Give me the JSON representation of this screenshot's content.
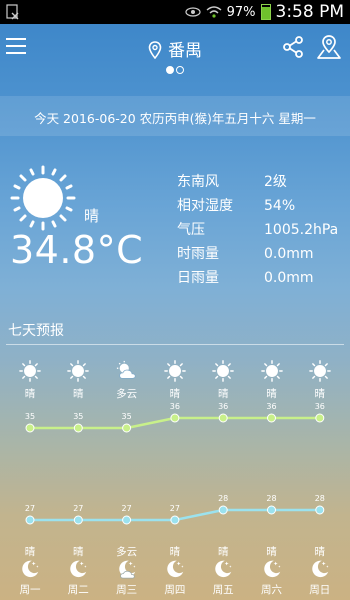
{
  "statusbar": {
    "signal_percent": "97%",
    "time": "3:58 PM",
    "icons": [
      "notification-icon",
      "eye-icon",
      "wifi-icon",
      "battery-icon"
    ]
  },
  "header": {
    "city": "番禺",
    "page_count": 2,
    "active_page": 0
  },
  "today": {
    "date_line": "今天   2016-06-20  农历丙申(猴)年五月十六  星期一",
    "condition": "晴",
    "temperature": "34.8°C",
    "details": [
      {
        "label": "东南风",
        "value": "2级"
      },
      {
        "label": "相对湿度",
        "value": "54%"
      },
      {
        "label": "气压",
        "value": "1005.2hPa"
      },
      {
        "label": "时雨量",
        "value": "0.0mm"
      },
      {
        "label": "日雨量",
        "value": "0.0mm"
      }
    ]
  },
  "week": {
    "title": "七天预报",
    "days": [
      {
        "day_icon": "sun-icon",
        "day_cond": "晴",
        "high": 35,
        "low": 27,
        "night_cond": "晴",
        "night_icon": "moon-icon",
        "name": "周一"
      },
      {
        "day_icon": "sun-icon",
        "day_cond": "晴",
        "high": 35,
        "low": 27,
        "night_cond": "晴",
        "night_icon": "moon-icon",
        "name": "周二"
      },
      {
        "day_icon": "cloud-sun-icon",
        "day_cond": "多云",
        "high": 35,
        "low": 27,
        "night_cond": "多云",
        "night_icon": "cloud-moon-icon",
        "name": "周三"
      },
      {
        "day_icon": "sun-icon",
        "day_cond": "晴",
        "high": 36,
        "low": 27,
        "night_cond": "晴",
        "night_icon": "moon-icon",
        "name": "周四"
      },
      {
        "day_icon": "sun-icon",
        "day_cond": "晴",
        "high": 36,
        "low": 28,
        "night_cond": "晴",
        "night_icon": "moon-icon",
        "name": "周五"
      },
      {
        "day_icon": "sun-icon",
        "day_cond": "晴",
        "high": 36,
        "low": 28,
        "night_cond": "晴",
        "night_icon": "moon-icon",
        "name": "周六"
      },
      {
        "day_icon": "sun-icon",
        "day_cond": "晴",
        "high": 36,
        "low": 28,
        "night_cond": "晴",
        "night_icon": "moon-icon",
        "name": "周日"
      }
    ]
  },
  "colors": {
    "high_line": "#c8f08a",
    "low_line": "#9be2ee"
  }
}
